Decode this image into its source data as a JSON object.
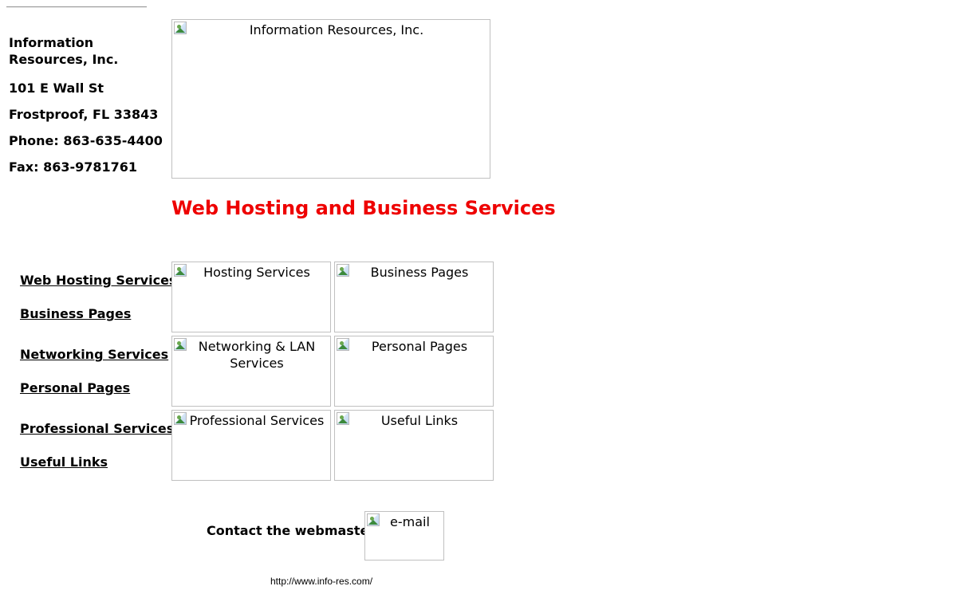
{
  "company": {
    "name": "Information Resources, Inc.",
    "address": "101 E Wall St",
    "city_state_zip": "Frostproof, FL 33843",
    "phone": "Phone: 863-635-4400",
    "fax": "Fax: 863-9781761"
  },
  "logo": {
    "alt": "Information Resources, Inc."
  },
  "headline": {
    "text": "Web Hosting and Business Services",
    "color": "#ee0000"
  },
  "nav_links": [
    "Web Hosting Services",
    "Business Pages",
    "Networking Services",
    "Personal Pages",
    "Professional Services",
    "Useful Links"
  ],
  "tiles": [
    "Hosting Services",
    "Business Pages",
    "Networking & LAN Services",
    "Personal Pages",
    "Professional Services",
    "Useful Links"
  ],
  "contact": {
    "label": "Contact the webmaster:",
    "email_alt": "e-mail"
  },
  "footer": {
    "url": "http://www.info-res.com/"
  },
  "icons": {
    "broken_image": "broken-image-icon"
  }
}
